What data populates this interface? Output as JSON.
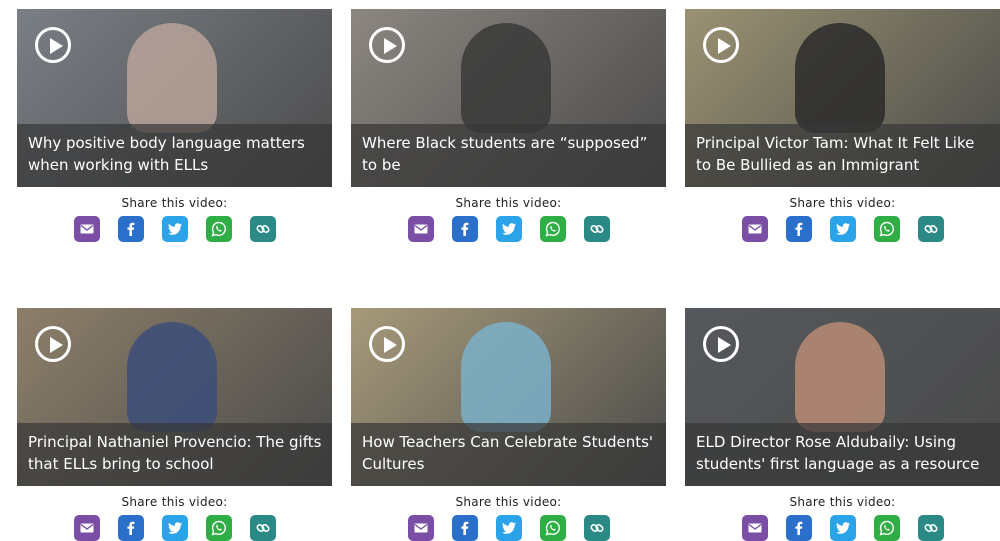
{
  "share_label": "Share this video:",
  "videos": [
    {
      "title": "Why positive body language matters when working with ELLs",
      "bg": "#7a7f86",
      "accent": "#b9a39a"
    },
    {
      "title": "Where Black students are “supposed” to be",
      "bg": "#8c8680",
      "accent": "#3a3a3a"
    },
    {
      "title": "Principal Victor Tam: What It Felt Like to Be Bullied as an Immigrant",
      "bg": "#9a9272",
      "accent": "#2a2a2a"
    },
    {
      "title": "Principal Nathaniel Provencio: The gifts that ELLs bring to school",
      "bg": "#8d7f6a",
      "accent": "#3c4e7a"
    },
    {
      "title": "How Teachers Can Celebrate Students' Cultures",
      "bg": "#a79a7a",
      "accent": "#7bb0c9"
    },
    {
      "title": "ELD Director Rose Aldubaily: Using students' first language as a resource",
      "bg": "#55585c",
      "accent": "#b88b76"
    }
  ],
  "share_buttons": [
    {
      "icon": "email-icon",
      "color": "#7b4ea6"
    },
    {
      "icon": "facebook-icon",
      "color": "#2a6fc9"
    },
    {
      "icon": "twitter-icon",
      "color": "#2aa3e8"
    },
    {
      "icon": "whatsapp-icon",
      "color": "#2fae46"
    },
    {
      "icon": "link-icon",
      "color": "#2c8a86"
    }
  ]
}
